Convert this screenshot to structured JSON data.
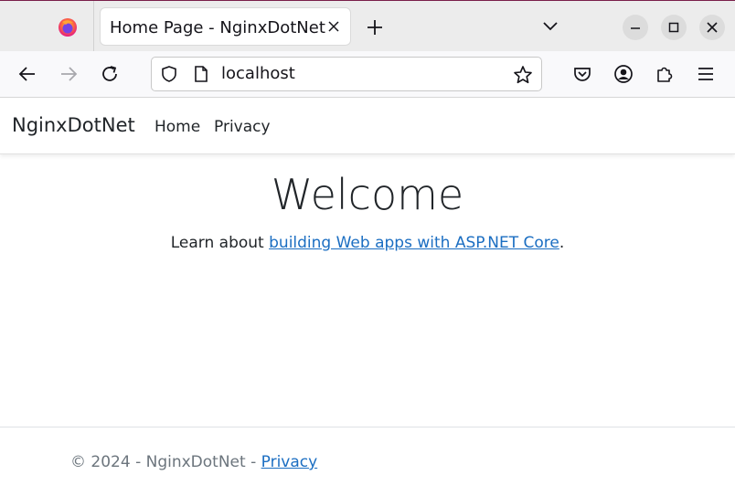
{
  "browser": {
    "tab_title": "Home Page - NginxDotNet",
    "url": "localhost"
  },
  "site": {
    "brand": "NginxDotNet",
    "nav": [
      "Home",
      "Privacy"
    ]
  },
  "main": {
    "heading": "Welcome",
    "lead_prefix": "Learn about ",
    "lead_link": "building Web apps with ASP.NET Core",
    "lead_suffix": "."
  },
  "footer": {
    "text": "© 2024 - NginxDotNet - ",
    "link": "Privacy"
  },
  "colors": {
    "link": "#1b6ec2",
    "text": "#212529",
    "muted": "#6c757d"
  }
}
